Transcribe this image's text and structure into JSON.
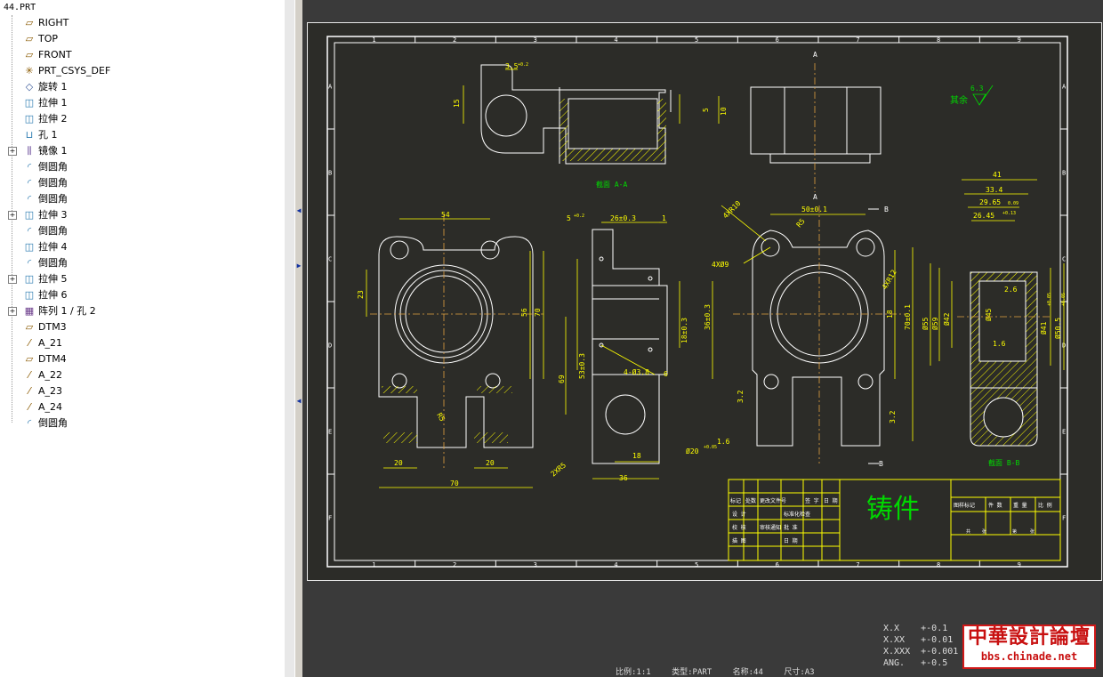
{
  "model_tree": {
    "root": "44.PRT",
    "items": [
      {
        "label": "RIGHT",
        "icon": "datum-plane-icon",
        "expandable": false
      },
      {
        "label": "TOP",
        "icon": "datum-plane-icon",
        "expandable": false
      },
      {
        "label": "FRONT",
        "icon": "datum-plane-icon",
        "expandable": false
      },
      {
        "label": "PRT_CSYS_DEF",
        "icon": "coordinate-system-icon",
        "expandable": false
      },
      {
        "label": "旋转 1",
        "icon": "revolve-icon",
        "expandable": false
      },
      {
        "label": "拉伸 1",
        "icon": "extrude-icon",
        "expandable": false
      },
      {
        "label": "拉伸 2",
        "icon": "extrude-icon",
        "expandable": false
      },
      {
        "label": "孔 1",
        "icon": "hole-icon",
        "expandable": false
      },
      {
        "label": "镜像 1",
        "icon": "mirror-icon",
        "expandable": true
      },
      {
        "label": "倒圆角",
        "icon": "round-icon",
        "expandable": false
      },
      {
        "label": "倒圆角",
        "icon": "round-icon",
        "expandable": false
      },
      {
        "label": "倒圆角",
        "icon": "round-icon",
        "expandable": false
      },
      {
        "label": "拉伸 3",
        "icon": "extrude-icon",
        "expandable": true
      },
      {
        "label": "倒圆角",
        "icon": "round-icon",
        "expandable": false
      },
      {
        "label": "拉伸 4",
        "icon": "extrude-icon",
        "expandable": false
      },
      {
        "label": "倒圆角",
        "icon": "round-icon",
        "expandable": false
      },
      {
        "label": "拉伸 5",
        "icon": "extrude-icon",
        "expandable": true
      },
      {
        "label": "拉伸 6",
        "icon": "extrude-icon",
        "expandable": false
      },
      {
        "label": "阵列 1 / 孔 2",
        "icon": "pattern-icon",
        "expandable": true
      },
      {
        "label": "DTM3",
        "icon": "datum-plane-icon",
        "expandable": false
      },
      {
        "label": "A_21",
        "icon": "datum-axis-icon",
        "expandable": false
      },
      {
        "label": "DTM4",
        "icon": "datum-plane-icon",
        "expandable": false
      },
      {
        "label": "A_22",
        "icon": "datum-axis-icon",
        "expandable": false
      },
      {
        "label": "A_23",
        "icon": "datum-axis-icon",
        "expandable": false
      },
      {
        "label": "A_24",
        "icon": "datum-axis-icon",
        "expandable": false
      },
      {
        "label": "倒圆角",
        "icon": "round-icon",
        "expandable": false
      }
    ]
  },
  "drawing": {
    "zone_numbers": [
      "1",
      "2",
      "3",
      "4",
      "5",
      "6",
      "7",
      "8",
      "9"
    ],
    "zone_letters": [
      "A",
      "B",
      "C",
      "D",
      "E",
      "F"
    ],
    "section_aa_label": "截面 A-A",
    "section_bb_label": "截面 B-B",
    "section_marks": {
      "a": "A",
      "b": "B"
    },
    "surface_finish": {
      "text": "其余",
      "value": "6.3"
    },
    "dims": {
      "d_3_5": "3.5",
      "d_3_5_tol": "+0.2",
      "d_15": "15",
      "d_5": "5",
      "d_10": "10",
      "d_54": "54",
      "d_23": "23",
      "d_56": "56",
      "d_70v": "70",
      "d_r5": "R5",
      "d_20a": "20",
      "d_20b": "20",
      "d_70h": "70",
      "d_5_0": "5",
      "d_5_0_tol": "+0.2",
      "d_26": "26±0.3",
      "d_1": "1",
      "d_18v": "18±0.3",
      "d_36v": "36±0.3",
      "d_53": "53±0.3",
      "d_69": "69",
      "d_4x38": "4-Ø3.8",
      "d_6": "6",
      "d_18h": "18",
      "d_36h": "36",
      "d_20dia": "Ø20",
      "d_20dia_tol": "+0.05",
      "d_16a": "1.6",
      "d_2x5": "2XR5",
      "d_4x10": "4XR10",
      "d_50": "50±0.1",
      "d_b": "B",
      "d_r5b": "R5",
      "d_4x9": "4XØ9",
      "d_4x12": "4XR12",
      "d_18r": "18",
      "d_70r": "70±0.1",
      "d_3_2a": "3.2",
      "d_3_2b": "3.2",
      "d_41": "41",
      "d_33_4": "33.4",
      "d_29_65": "29.65",
      "d_29_65_tol": "0.09",
      "d_26_45": "26.45",
      "d_26_45_tol": "+0.13",
      "d_2_6": "2.6",
      "d_55": "Ø55",
      "d_59": "Ø59",
      "d_42": "Ø42",
      "d_45": "Ø45",
      "d_41dia": "Ø41",
      "d_41dia_tol": "+0.05",
      "d_50_5": "Ø50.5",
      "d_50_5_tol": "+0.05",
      "d_16b": "1.6"
    },
    "title_block": {
      "part_name": "铸件",
      "headers_left": [
        "标记",
        "处数",
        "更改文件号",
        "签 字",
        "日 期"
      ],
      "rows_left": [
        [
          "设 计",
          "",
          "",
          "标准化检查",
          ""
        ],
        [
          "校 核",
          "",
          "审核通知",
          "批 准",
          ""
        ],
        [
          "描 图",
          "",
          "",
          "日 期",
          ""
        ]
      ],
      "headers_right": [
        "图样标记",
        "件 数",
        "重 量",
        "比 例"
      ],
      "sheet_row": [
        "共",
        "张",
        "第",
        "张"
      ]
    }
  },
  "status_bar": {
    "scale": "比例:1:1",
    "type": "类型:PART",
    "name": "名称:44",
    "size": "尺寸:A3"
  },
  "tolerances": [
    "X.X    +-0.1",
    "X.XX   +-0.01",
    "X.XXX  +-0.001",
    "ANG.   +-0.5"
  ],
  "watermark": {
    "title": "中華設計論壇",
    "url": "bbs.chinade.net"
  },
  "colors": {
    "sheet_bg": "#2c2c28",
    "line": "#ffffff",
    "dimension": "#ffff00",
    "centerline": "#e0a040",
    "text_green": "#00d800",
    "hatch": "#ffff00"
  }
}
